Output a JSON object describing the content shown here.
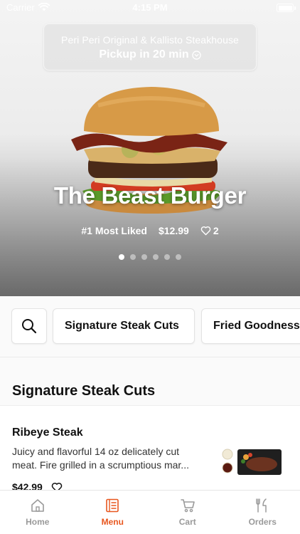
{
  "status_bar": {
    "carrier": "Carrier",
    "time": "4:15 PM"
  },
  "store": {
    "name": "Peri Peri Original & Kallisto Steakhouse",
    "pickup": "Pickup in 20 min"
  },
  "featured": {
    "title": "The Beast Burger",
    "badge": "#1 Most Liked",
    "price": "$12.99",
    "likes": "2",
    "slide_count": 6,
    "active_slide": 1
  },
  "categories": {
    "items": [
      "Signature Steak Cuts",
      "Fried Goodness"
    ]
  },
  "section": {
    "title": "Signature Steak Cuts"
  },
  "menu_item": {
    "name": "Ribeye Steak",
    "description": "Juicy and flavorful 14 oz delicately cut meat. Fire grilled in a scrumptious mar...",
    "price": "$42.99"
  },
  "tabs": [
    {
      "label": "Home",
      "icon": "home-icon",
      "active": false
    },
    {
      "label": "Menu",
      "icon": "menu-icon",
      "active": true
    },
    {
      "label": "Cart",
      "icon": "cart-icon",
      "active": false
    },
    {
      "label": "Orders",
      "icon": "orders-icon",
      "active": false
    }
  ],
  "colors": {
    "accent": "#e8571f",
    "inactive_tab": "#9a9a9a"
  }
}
